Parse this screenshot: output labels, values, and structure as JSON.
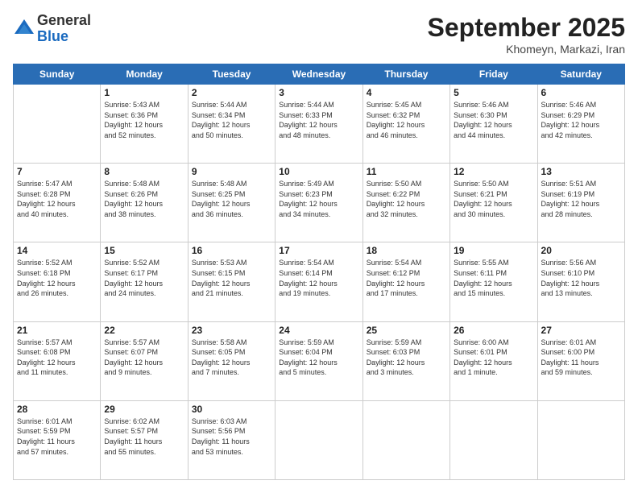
{
  "header": {
    "logo": {
      "line1": "General",
      "line2": "Blue"
    },
    "title": "September 2025",
    "location": "Khomeyn, Markazi, Iran"
  },
  "days_of_week": [
    "Sunday",
    "Monday",
    "Tuesday",
    "Wednesday",
    "Thursday",
    "Friday",
    "Saturday"
  ],
  "weeks": [
    [
      {
        "day": "",
        "info": ""
      },
      {
        "day": "1",
        "info": "Sunrise: 5:43 AM\nSunset: 6:36 PM\nDaylight: 12 hours\nand 52 minutes."
      },
      {
        "day": "2",
        "info": "Sunrise: 5:44 AM\nSunset: 6:34 PM\nDaylight: 12 hours\nand 50 minutes."
      },
      {
        "day": "3",
        "info": "Sunrise: 5:44 AM\nSunset: 6:33 PM\nDaylight: 12 hours\nand 48 minutes."
      },
      {
        "day": "4",
        "info": "Sunrise: 5:45 AM\nSunset: 6:32 PM\nDaylight: 12 hours\nand 46 minutes."
      },
      {
        "day": "5",
        "info": "Sunrise: 5:46 AM\nSunset: 6:30 PM\nDaylight: 12 hours\nand 44 minutes."
      },
      {
        "day": "6",
        "info": "Sunrise: 5:46 AM\nSunset: 6:29 PM\nDaylight: 12 hours\nand 42 minutes."
      }
    ],
    [
      {
        "day": "7",
        "info": "Sunrise: 5:47 AM\nSunset: 6:28 PM\nDaylight: 12 hours\nand 40 minutes."
      },
      {
        "day": "8",
        "info": "Sunrise: 5:48 AM\nSunset: 6:26 PM\nDaylight: 12 hours\nand 38 minutes."
      },
      {
        "day": "9",
        "info": "Sunrise: 5:48 AM\nSunset: 6:25 PM\nDaylight: 12 hours\nand 36 minutes."
      },
      {
        "day": "10",
        "info": "Sunrise: 5:49 AM\nSunset: 6:23 PM\nDaylight: 12 hours\nand 34 minutes."
      },
      {
        "day": "11",
        "info": "Sunrise: 5:50 AM\nSunset: 6:22 PM\nDaylight: 12 hours\nand 32 minutes."
      },
      {
        "day": "12",
        "info": "Sunrise: 5:50 AM\nSunset: 6:21 PM\nDaylight: 12 hours\nand 30 minutes."
      },
      {
        "day": "13",
        "info": "Sunrise: 5:51 AM\nSunset: 6:19 PM\nDaylight: 12 hours\nand 28 minutes."
      }
    ],
    [
      {
        "day": "14",
        "info": "Sunrise: 5:52 AM\nSunset: 6:18 PM\nDaylight: 12 hours\nand 26 minutes."
      },
      {
        "day": "15",
        "info": "Sunrise: 5:52 AM\nSunset: 6:17 PM\nDaylight: 12 hours\nand 24 minutes."
      },
      {
        "day": "16",
        "info": "Sunrise: 5:53 AM\nSunset: 6:15 PM\nDaylight: 12 hours\nand 21 minutes."
      },
      {
        "day": "17",
        "info": "Sunrise: 5:54 AM\nSunset: 6:14 PM\nDaylight: 12 hours\nand 19 minutes."
      },
      {
        "day": "18",
        "info": "Sunrise: 5:54 AM\nSunset: 6:12 PM\nDaylight: 12 hours\nand 17 minutes."
      },
      {
        "day": "19",
        "info": "Sunrise: 5:55 AM\nSunset: 6:11 PM\nDaylight: 12 hours\nand 15 minutes."
      },
      {
        "day": "20",
        "info": "Sunrise: 5:56 AM\nSunset: 6:10 PM\nDaylight: 12 hours\nand 13 minutes."
      }
    ],
    [
      {
        "day": "21",
        "info": "Sunrise: 5:57 AM\nSunset: 6:08 PM\nDaylight: 12 hours\nand 11 minutes."
      },
      {
        "day": "22",
        "info": "Sunrise: 5:57 AM\nSunset: 6:07 PM\nDaylight: 12 hours\nand 9 minutes."
      },
      {
        "day": "23",
        "info": "Sunrise: 5:58 AM\nSunset: 6:05 PM\nDaylight: 12 hours\nand 7 minutes."
      },
      {
        "day": "24",
        "info": "Sunrise: 5:59 AM\nSunset: 6:04 PM\nDaylight: 12 hours\nand 5 minutes."
      },
      {
        "day": "25",
        "info": "Sunrise: 5:59 AM\nSunset: 6:03 PM\nDaylight: 12 hours\nand 3 minutes."
      },
      {
        "day": "26",
        "info": "Sunrise: 6:00 AM\nSunset: 6:01 PM\nDaylight: 12 hours\nand 1 minute."
      },
      {
        "day": "27",
        "info": "Sunrise: 6:01 AM\nSunset: 6:00 PM\nDaylight: 11 hours\nand 59 minutes."
      }
    ],
    [
      {
        "day": "28",
        "info": "Sunrise: 6:01 AM\nSunset: 5:59 PM\nDaylight: 11 hours\nand 57 minutes."
      },
      {
        "day": "29",
        "info": "Sunrise: 6:02 AM\nSunset: 5:57 PM\nDaylight: 11 hours\nand 55 minutes."
      },
      {
        "day": "30",
        "info": "Sunrise: 6:03 AM\nSunset: 5:56 PM\nDaylight: 11 hours\nand 53 minutes."
      },
      {
        "day": "",
        "info": ""
      },
      {
        "day": "",
        "info": ""
      },
      {
        "day": "",
        "info": ""
      },
      {
        "day": "",
        "info": ""
      }
    ]
  ]
}
